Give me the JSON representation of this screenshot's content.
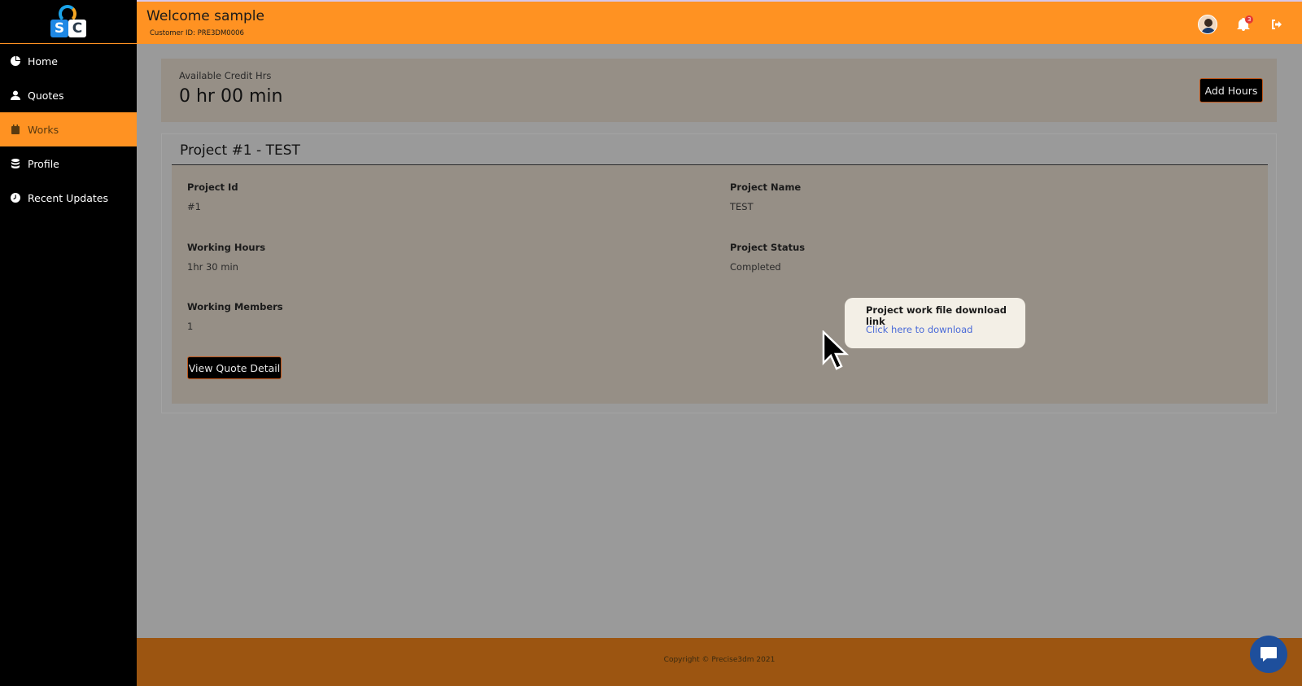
{
  "header": {
    "welcome": "Welcome sample",
    "customer_id": "Customer ID: PRE3DM0006",
    "notification_count": "3"
  },
  "sidebar": {
    "items": [
      {
        "label": "Home",
        "icon": "home-icon"
      },
      {
        "label": "Quotes",
        "icon": "user-icon"
      },
      {
        "label": "Works",
        "icon": "calendar-icon"
      },
      {
        "label": "Profile",
        "icon": "database-icon"
      },
      {
        "label": "Recent Updates",
        "icon": "clock-icon"
      }
    ],
    "active": "Works"
  },
  "credit": {
    "label": "Available Credit Hrs",
    "value": "0 hr 00 min",
    "add_button": "Add Hours"
  },
  "project": {
    "title": "Project #1 - TEST",
    "fields": {
      "id_label": "Project Id",
      "id_value": "#1",
      "name_label": "Project Name",
      "name_value": "TEST",
      "hours_label": "Working Hours",
      "hours_value": "1hr 30 min",
      "status_label": "Project Status",
      "status_value": "Completed",
      "members_label": "Working Members",
      "members_value": "1",
      "download_label": "Project work file download link",
      "download_link": "Click here to download"
    },
    "view_quote_button": "View Quote Detail"
  },
  "footer": {
    "copyright": "Copyright © Precise3dm 2021"
  },
  "colors": {
    "accent": "#ff9222",
    "sidebar": "#000000",
    "footer": "#9c5511",
    "link": "#4a6ad8"
  }
}
